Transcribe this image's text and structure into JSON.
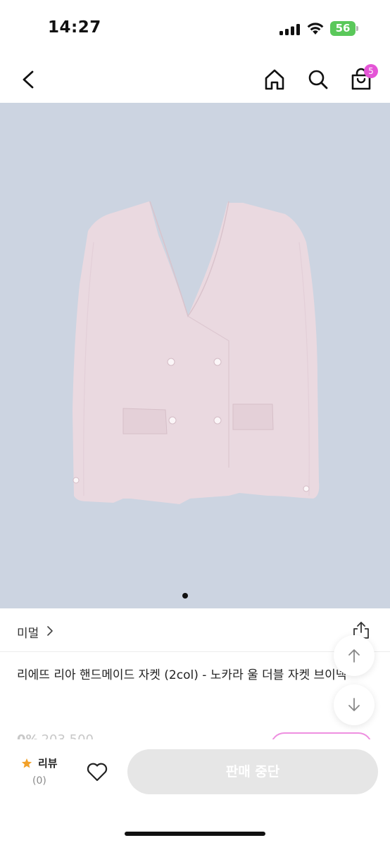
{
  "status_bar": {
    "time": "14:27",
    "battery": "56",
    "icons": [
      "signal-icon",
      "wifi-icon",
      "battery-icon"
    ]
  },
  "nav": {
    "icons": [
      "back-arrow-icon",
      "home-icon",
      "search-icon",
      "shopping-bag-icon"
    ],
    "cart_badge": "5",
    "badge_color": "#e455d6"
  },
  "product": {
    "image_icon": "jacket-photo",
    "background_color": "#ccd4e1",
    "carousel_pages": 1,
    "seller": "미멀",
    "title": "리에뜨 리아 핸드메이드 자켓 (2col) - 노카라 울 더블 자켓 브이넥",
    "price_partial": "0%",
    "price_old_partial": "203,500"
  },
  "floating": {
    "icons": [
      "arrow-up-icon",
      "arrow-down-icon",
      "share-icon"
    ]
  },
  "bottom_bar": {
    "review_label": "리뷰",
    "review_count": "(0)",
    "star_color": "#f2a12a",
    "cta_label": "판매 중단",
    "cta_color": "#e6e6e6"
  }
}
